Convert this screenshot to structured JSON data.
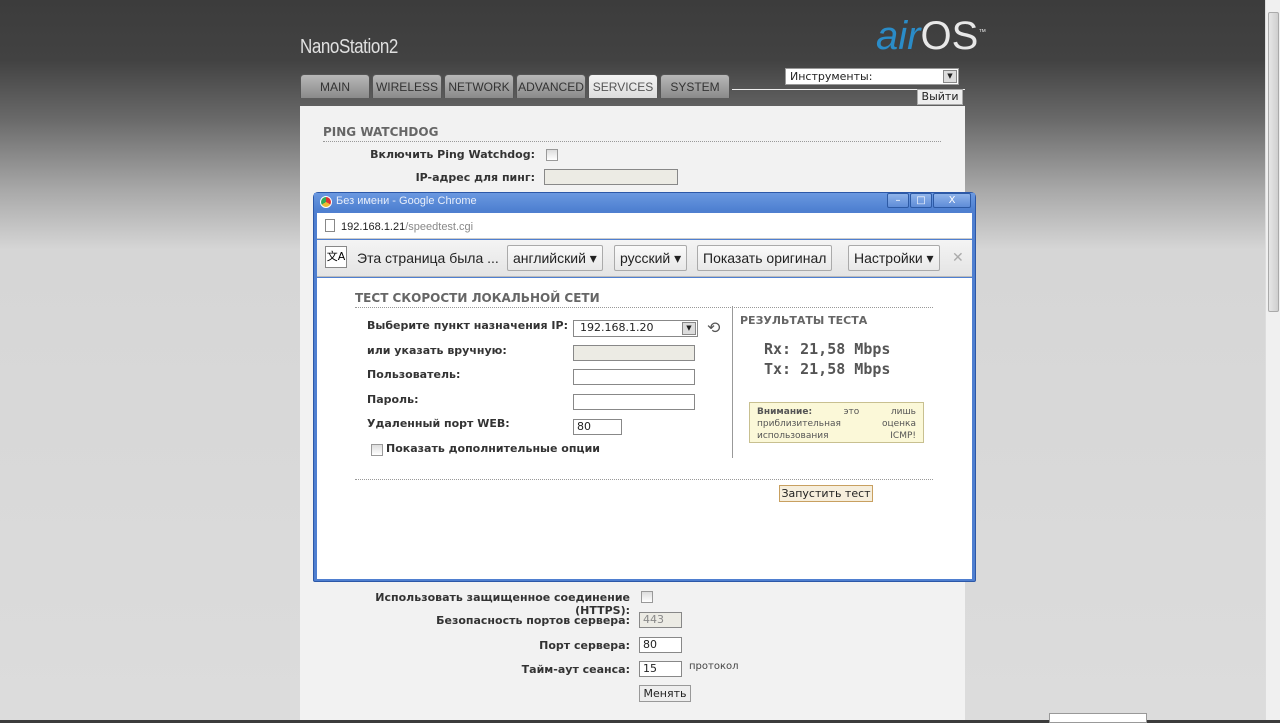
{
  "header": {
    "device": "NanoStation2",
    "logo_air": "air",
    "logo_os": "OS",
    "logo_tm": "™"
  },
  "tabs": [
    {
      "label": "MAIN"
    },
    {
      "label": "WIRELESS"
    },
    {
      "label": "NETWORK"
    },
    {
      "label": "ADVANCED"
    },
    {
      "label": "SERVICES",
      "active": true
    },
    {
      "label": "SYSTEM"
    }
  ],
  "tools": {
    "value": "Инструменты:",
    "logout": "Выйти"
  },
  "ping": {
    "title": "PING WATCHDOG",
    "enable_label": "Включить Ping Watchdog:",
    "ip_label": "IP-адрес для пинг:",
    "ip_value": ""
  },
  "web": {
    "https_label": "Использовать защищенное соединение (HTTPS):",
    "secure_port_label": "Безопасность портов сервера:",
    "secure_port": "443",
    "port_label": "Порт сервера:",
    "port": "80",
    "timeout_label": "Тайм-аут сеанса:",
    "timeout": "15",
    "timeout_unit": "протокол",
    "change": "Менять"
  },
  "popup": {
    "title": "Без имени - Google Chrome",
    "url_host": "192.168.1.21",
    "url_path": "/speedtest.cgi",
    "translate": {
      "msg": "Эта страница была ...",
      "from": "английский ▾",
      "to": "русский ▾",
      "show_original": "Показать оригинал",
      "settings": "Настройки ▾",
      "close": "✕"
    },
    "section": "ТЕСТ СКОРОСТИ ЛОКАЛЬНОЙ СЕТИ",
    "dest_label": "Выберите пункт назначения IP:",
    "dest_value": "192.168.1.20",
    "manual_label": "или указать вручную:",
    "manual_value": "",
    "user_label": "Пользователь:",
    "user_value": "",
    "pass_label": "Пароль:",
    "pass_value": "",
    "port_label": "Удаленный порт WEB:",
    "port_value": "80",
    "advanced_label": "Показать дополнительные опции",
    "results_title": "РЕЗУЛЬТАТЫ ТЕСТА",
    "rx": "Rx: 21,58 Mbps",
    "tx": "Tx: 21,58 Mbps",
    "warn_bold": "Внимание:",
    "warn_text": " это лишь приблизительная оценка использования ICMP!",
    "run": "Запустить тест"
  }
}
